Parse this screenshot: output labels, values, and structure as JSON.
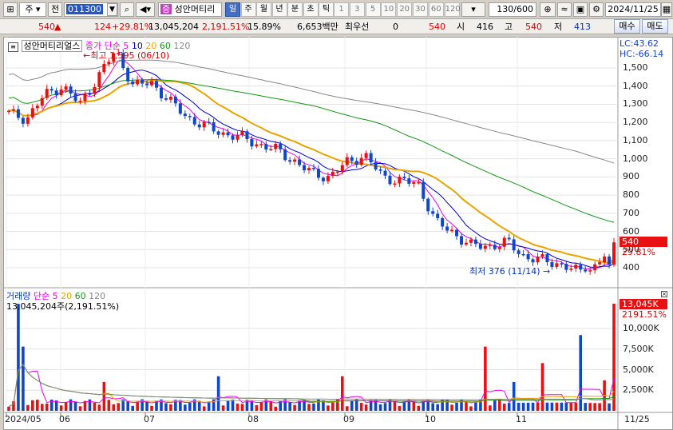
{
  "toolbar": {
    "market": "주",
    "type_label": "전",
    "code": "011300",
    "name_tag": "증",
    "stock_name": "성안머티리",
    "period_tabs": [
      "일",
      "주",
      "월",
      "년",
      "분",
      "초",
      "틱"
    ],
    "active_period": "일",
    "intervals": [
      "1",
      "3",
      "5",
      "10",
      "20",
      "30",
      "60",
      "120"
    ],
    "count": "130/600",
    "date": "2024/11/25"
  },
  "quote": {
    "price": "540",
    "change": "124",
    "change_rate": "+29.81%",
    "volume": "13,045,204",
    "volume_rate": "2,191.51%",
    "turnover": "15.89%",
    "amount": "6,653백만",
    "best_bid_label": "최우선",
    "best_bid_qty": "0",
    "best_bid_price": "540",
    "open_label": "시",
    "open": "416",
    "high_label": "고",
    "high": "540",
    "low_label": "저",
    "low": "413"
  },
  "side_buttons": {
    "buy": "매수",
    "sell": "매도"
  },
  "price_chart": {
    "title": "성안머티리얼스",
    "ma_label": "종가 단순",
    "ma_periods": [
      "5",
      "10",
      "20",
      "60",
      "120"
    ],
    "ma_colors": [
      "#ee00ee",
      "#0000cc",
      "#e8a400",
      "#119911",
      "#888888"
    ],
    "lc_label": "LC:43.62",
    "hc_label": "HC:-66.14",
    "high_marker": "최고 1,595 (06/10)",
    "low_marker": "최저 376 (11/14)",
    "y_ticks": [
      "1,500",
      "1,400",
      "1,300",
      "1,200",
      "1,100",
      "1,000",
      "900",
      "800",
      "700",
      "600",
      "500",
      "400"
    ],
    "last_price": "540",
    "last_rate": "29.81%"
  },
  "volume_chart": {
    "title": "거래량",
    "ma_label": "단순",
    "ma_periods": [
      "5",
      "20",
      "60",
      "120"
    ],
    "ma_colors": [
      "#ee00ee",
      "#e8a400",
      "#119911",
      "#888888"
    ],
    "volume_text": "13,045,204주(2,191.51%)",
    "y_ticks": [
      "10,000K",
      "7,500K",
      "5,000K",
      "2,500K"
    ],
    "last_volume": "13,045K",
    "last_rate": "2191.51%"
  },
  "x_axis": {
    "labels": [
      "2024/05",
      "06",
      "07",
      "08",
      "09",
      "10",
      "11"
    ],
    "right_label": "11/25"
  },
  "chart_data": {
    "type": "candlestick",
    "unit": "KRW",
    "price_ylim": [
      376,
      1595
    ],
    "volume_ylim": [
      0,
      13045
    ],
    "x": [
      "2024/05",
      "06",
      "07",
      "08",
      "09",
      "10",
      "11",
      "11/25"
    ],
    "price_points": [
      [
        "2024/05",
        1250
      ],
      [
        "05",
        1220
      ],
      [
        "05",
        1350
      ],
      [
        "05",
        1400
      ],
      [
        "05",
        1300
      ],
      [
        "06",
        1450
      ],
      [
        "06/10",
        1595
      ],
      [
        "06",
        1400
      ],
      [
        "06",
        1420
      ],
      [
        "06",
        1320
      ],
      [
        "06",
        1230
      ],
      [
        "07",
        1180
      ],
      [
        "07",
        1140
      ],
      [
        "07",
        1120
      ],
      [
        "07",
        1080
      ],
      [
        "07",
        1050
      ],
      [
        "08",
        990
      ],
      [
        "08",
        920
      ],
      [
        "08",
        900
      ],
      [
        "08",
        980
      ],
      [
        "08",
        1020
      ],
      [
        "09",
        900
      ],
      [
        "09",
        880
      ],
      [
        "09",
        860
      ],
      [
        "09",
        650
      ],
      [
        "09",
        590
      ],
      [
        "10",
        520
      ],
      [
        "10",
        520
      ],
      [
        "10",
        540
      ],
      [
        "10",
        460
      ],
      [
        "11",
        440
      ],
      [
        "11",
        420
      ],
      [
        "11/14",
        376
      ],
      [
        "11",
        410
      ],
      [
        "11/25",
        540
      ]
    ],
    "volume_points_k": [
      [
        "2024/05",
        13000
      ],
      [
        "05",
        7800
      ],
      [
        "06",
        3500
      ],
      [
        "07",
        4200
      ],
      [
        "08",
        4200
      ],
      [
        "09",
        7800
      ],
      [
        "10",
        5800
      ],
      [
        "10",
        9200
      ],
      [
        "11",
        3700
      ],
      [
        "11/25",
        13045
      ]
    ]
  }
}
